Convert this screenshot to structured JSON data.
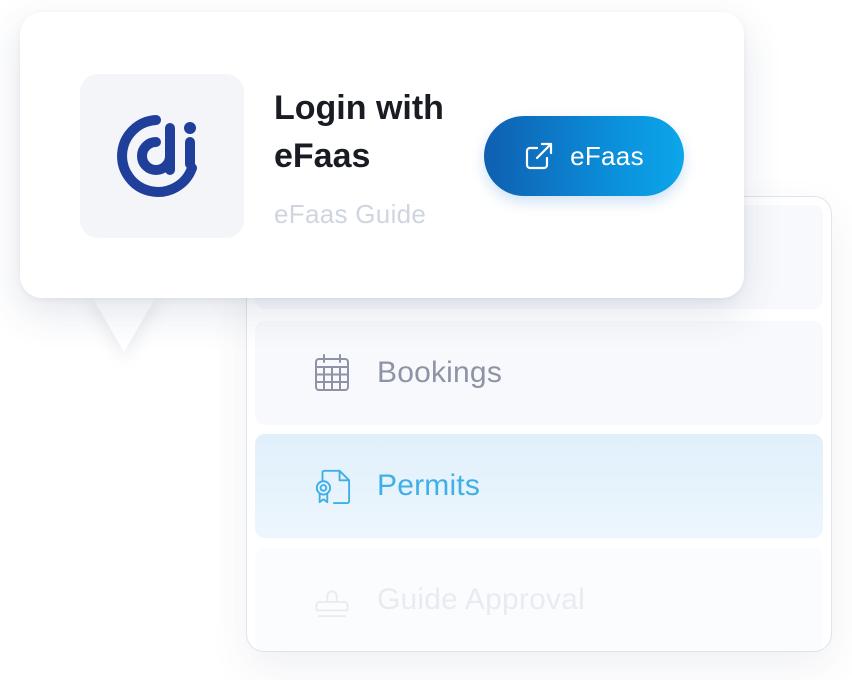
{
  "login_card": {
    "title": "Login with eFaas",
    "subtitle": "eFaas Guide",
    "logo_icon": "efaas-di-logo",
    "button": {
      "label": "eFaas",
      "icon": "external-link-icon"
    }
  },
  "menu": {
    "items": [
      {
        "label": "",
        "icon": "",
        "state": "default"
      },
      {
        "label": "Bookings",
        "icon": "calendar-icon",
        "state": "default"
      },
      {
        "label": "Permits",
        "icon": "certificate-document-icon",
        "state": "active"
      },
      {
        "label": "Guide Approval",
        "icon": "stamp-icon",
        "state": "faded"
      }
    ]
  },
  "colors": {
    "brand_blue": "#1f3f9a",
    "button_gradient_start": "#0f5fb0",
    "button_gradient_end": "#0da6ea",
    "active_text": "#3fb0e6",
    "muted_text": "#8e94a5"
  }
}
